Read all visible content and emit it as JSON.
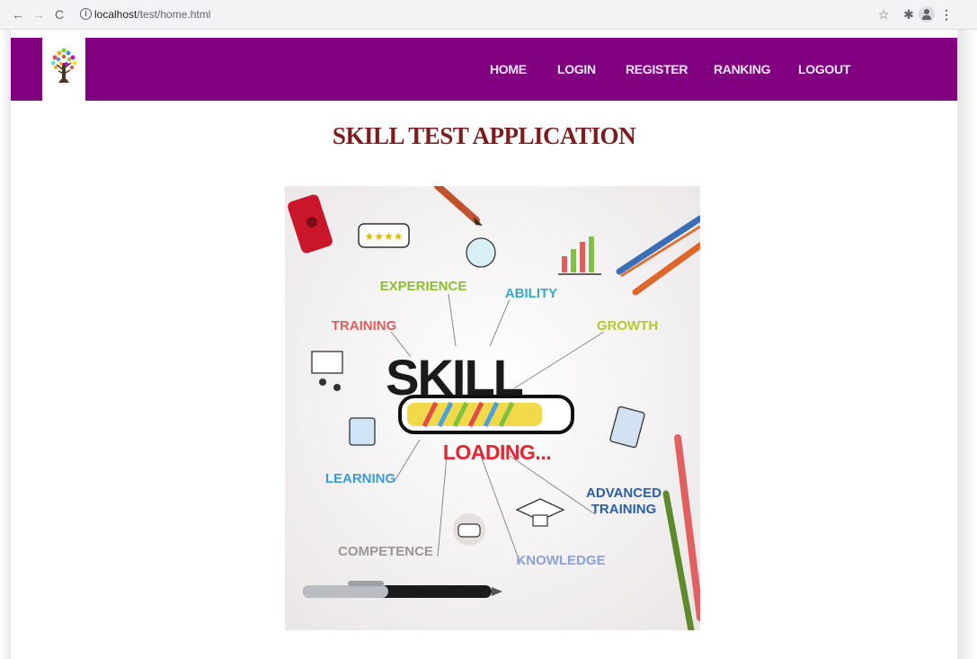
{
  "browser": {
    "url_host": "localhost",
    "url_path": "/test/home.html",
    "icons": {
      "back": "arrow-left-icon",
      "forward": "arrow-right-icon",
      "reload": "reload-icon",
      "info": "info-icon",
      "bookmark": "star-icon",
      "extensions": "puzzle-icon",
      "profile": "profile-icon",
      "menu": "kebab-menu-icon"
    }
  },
  "navbar": {
    "background": "#800080",
    "links": [
      {
        "label": "HOME"
      },
      {
        "label": "LOGIN"
      },
      {
        "label": "REGISTER"
      },
      {
        "label": "RANKING"
      },
      {
        "label": "LOGOUT"
      }
    ]
  },
  "page": {
    "title": "SKILL TEST APPLICATION",
    "title_color": "#7b1d1d"
  },
  "hero": {
    "main_word": "SKILL",
    "loading_text": "LOADING...",
    "labels": {
      "experience": "EXPERIENCE",
      "ability": "ABILITY",
      "training": "TRAINING",
      "growth": "GROWTH",
      "learning": "LEARNING",
      "advanced_line1": "ADVANCED",
      "advanced_line2": "TRAINING",
      "competence": "COMPETENCE",
      "knowledge": "KNOWLEDGE"
    }
  }
}
